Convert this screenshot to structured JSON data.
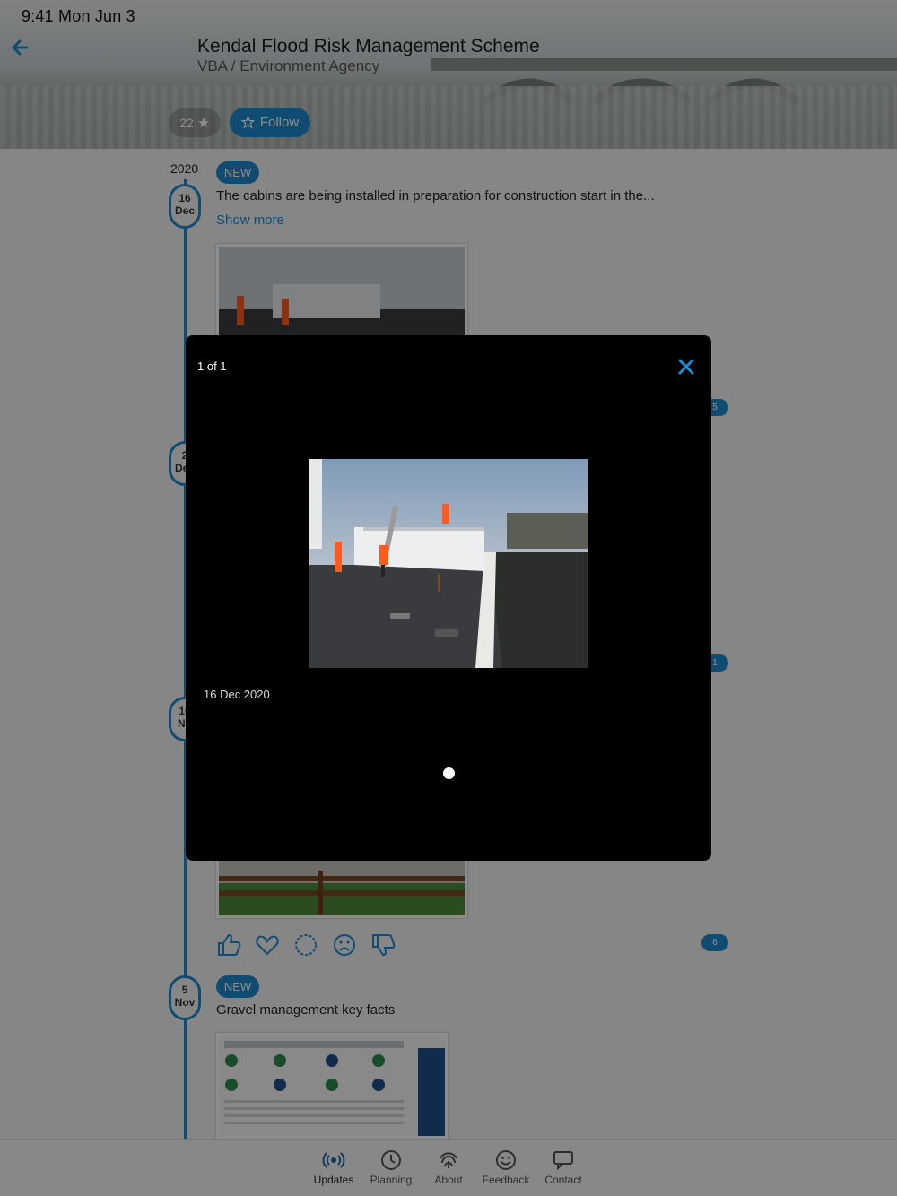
{
  "status": {
    "time": "9:41  Mon Jun 3"
  },
  "header": {
    "title": "Kendal Flood Risk Management Scheme",
    "subtitle": "VBA / Environment Agency",
    "rating": "22",
    "follow_label": "Follow"
  },
  "timeline": {
    "year": "2020",
    "entries": [
      {
        "day": "16",
        "month": "Dec",
        "badge": "NEW",
        "text": "The cabins are being installed in preparation for construction start in the...",
        "show_more": "Show more",
        "count": "5"
      },
      {
        "day": "2",
        "month": "Dec",
        "count": "1"
      },
      {
        "day": "10",
        "month": "No",
        "count": "6"
      },
      {
        "day": "5",
        "month": "Nov",
        "badge": "NEW",
        "text": "Gravel management key facts"
      }
    ]
  },
  "modal": {
    "counter": "1 of 1",
    "date": "16 Dec 2020"
  },
  "tabbar": {
    "items": [
      {
        "label": "Updates",
        "icon": "broadcast-icon"
      },
      {
        "label": "Planning",
        "icon": "clock-icon"
      },
      {
        "label": "About",
        "icon": "fingerprint-icon"
      },
      {
        "label": "Feedback",
        "icon": "smiley-icon"
      },
      {
        "label": "Contact",
        "icon": "chat-icon"
      }
    ]
  },
  "colors": {
    "accent": "#1e8bd0",
    "modal_bg": "#000000"
  }
}
